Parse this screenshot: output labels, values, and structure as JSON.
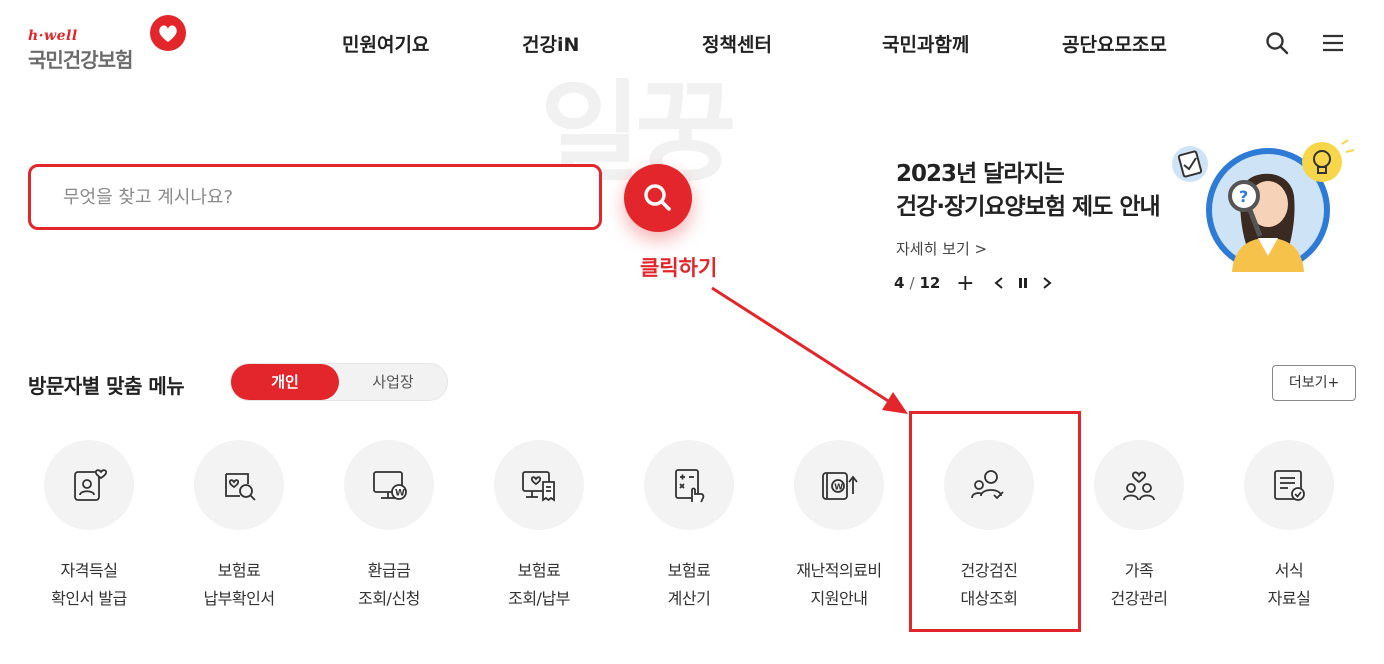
{
  "header": {
    "logo_sub": "h·well",
    "logo_main": "국민건강보험",
    "nav": [
      "민원여기요",
      "건강iN",
      "정책센터",
      "국민과함께",
      "공단요모조모"
    ],
    "icons": [
      "search-icon",
      "hamburger-menu-icon"
    ]
  },
  "watermark": "일꿍",
  "search": {
    "placeholder": "무엇을 찾고 계시나요?",
    "button_icon": "search-icon"
  },
  "annotation": {
    "label": "클릭하기",
    "color": "#e3262b"
  },
  "banner": {
    "title_line1": "2023년 달라지는",
    "title_line2": "건강·장기요양보험 제도 안내",
    "more": "자세히 보기 >",
    "pager": {
      "current": "4",
      "separator": "/",
      "total": "12",
      "add": "+"
    }
  },
  "section": {
    "title": "방문자별 맞춤 메뉴",
    "toggle": [
      "개인",
      "사업장"
    ],
    "active_toggle": "개인",
    "more": "더보기+"
  },
  "menu": [
    {
      "line1": "자격득실",
      "line2": "확인서 발급",
      "icon": "id-card-heart-icon"
    },
    {
      "line1": "보험료",
      "line2": "납부확인서",
      "icon": "document-search-icon"
    },
    {
      "line1": "환급금",
      "line2": "조회/신청",
      "icon": "monitor-won-icon"
    },
    {
      "line1": "보험료",
      "line2": "조회/납부",
      "icon": "monitor-receipt-icon"
    },
    {
      "line1": "보험료",
      "line2": "계산기",
      "icon": "calculator-hand-icon"
    },
    {
      "line1": "재난적의료비",
      "line2": "지원안내",
      "icon": "wallet-won-arrow-icon"
    },
    {
      "line1": "건강검진",
      "line2": "대상조회",
      "icon": "people-check-icon"
    },
    {
      "line1": "가족",
      "line2": "건강관리",
      "icon": "family-heart-icon"
    },
    {
      "line1": "서식",
      "line2": "자료실",
      "icon": "form-check-icon"
    }
  ],
  "colors": {
    "accent": "#e3262b",
    "text": "#222222",
    "circle_bg": "#f3f3f3"
  }
}
